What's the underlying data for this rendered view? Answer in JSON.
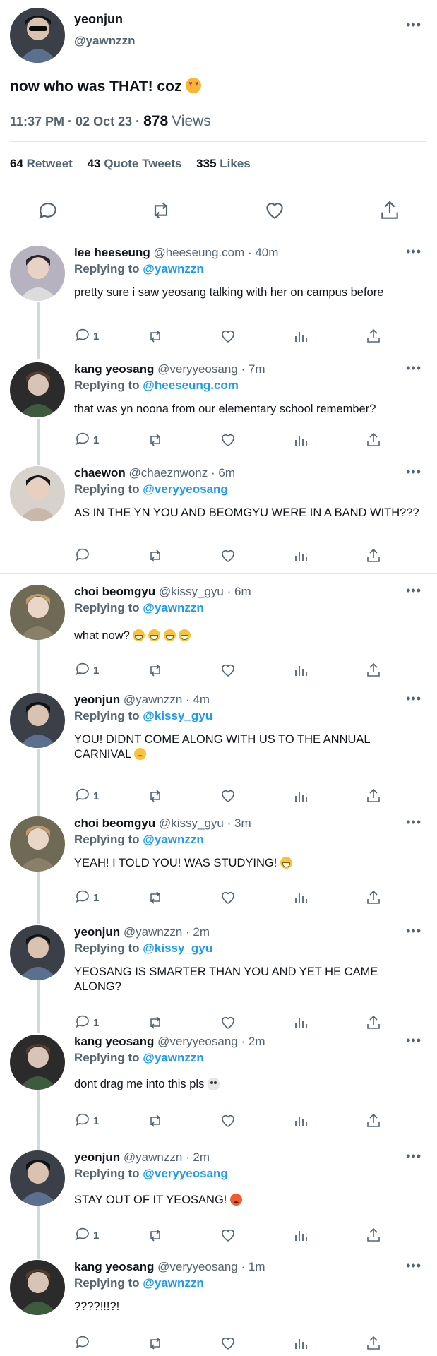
{
  "main_tweet": {
    "name": "yeonjun",
    "handle": "@yawnzzn",
    "text": "now who was THAT! coz",
    "time": "11:37 PM · 02 Oct 23 ·",
    "views_count": "878",
    "views_label": "Views",
    "stats": {
      "retweets": "64",
      "retweets_label": "Retweet",
      "quotes": "43",
      "quotes_label": "Quote Tweets",
      "likes": "335",
      "likes_label": "Likes"
    }
  },
  "replying_label": "Replying to",
  "replies": [
    {
      "name": "lee heeseung",
      "handle": "@heeseung.com",
      "time": "· 40m",
      "to": "@yawnzzn",
      "text": "pretty sure i saw yeosang talking with her on campus before",
      "reply_count": "1"
    },
    {
      "name": "kang yeosang",
      "handle": "@veryyeosang",
      "time": "· 7m",
      "to": "@heeseung.com",
      "text": "that was yn noona from our elementary school remember?",
      "reply_count": "1"
    },
    {
      "name": "chaewon",
      "handle": "@chaeznwonz",
      "time": "· 6m",
      "to": "@veryyeosang",
      "text": "AS IN THE YN YOU AND BEOMGYU WERE IN A BAND WITH???",
      "reply_count": ""
    },
    {
      "name": "choi beomgyu",
      "handle": "@kissy_gyu",
      "time": "· 6m",
      "to": "@yawnzzn",
      "text": "what now?",
      "reply_count": "1"
    },
    {
      "name": "yeonjun",
      "handle": "@yawnzzn",
      "time": "· 4m",
      "to": "@kissy_gyu",
      "text": "YOU! DIDNT COME ALONG WITH US TO THE ANNUAL CARNIVAL",
      "reply_count": "1"
    },
    {
      "name": "choi beomgyu",
      "handle": "@kissy_gyu",
      "time": "· 3m",
      "to": "@yawnzzn",
      "text": "YEAH! I TOLD YOU! WAS STUDYING!",
      "reply_count": "1"
    },
    {
      "name": "yeonjun",
      "handle": "@yawnzzn",
      "time": "· 2m",
      "to": "@kissy_gyu",
      "text": "YEOSANG IS SMARTER THAN YOU AND YET HE CAME ALONG?",
      "reply_count": "1"
    },
    {
      "name": "kang yeosang",
      "handle": "@veryyeosang",
      "time": "· 2m",
      "to": "@yawnzzn",
      "text": "dont drag me into this pls",
      "reply_count": "1"
    },
    {
      "name": "yeonjun",
      "handle": "@yawnzzn",
      "time": "· 2m",
      "to": "@veryyeosang",
      "text": "STAY OUT OF IT YEOSANG!",
      "reply_count": "1"
    },
    {
      "name": "kang yeosang",
      "handle": "@veryyeosang",
      "time": "· 1m",
      "to": "@yawnzzn",
      "text": "????!!!?!",
      "reply_count": ""
    }
  ]
}
